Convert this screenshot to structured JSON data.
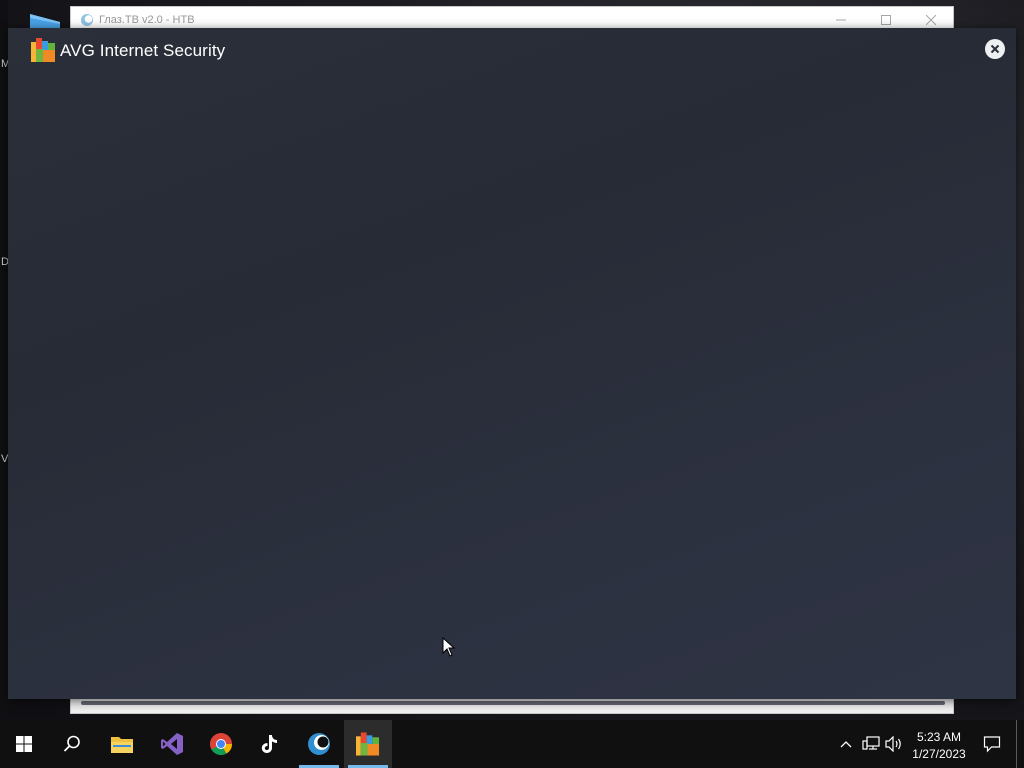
{
  "desktop": {
    "left_strip_chars": [
      "M",
      "D",
      "V"
    ]
  },
  "background_window": {
    "title": "Глаз.ТВ v2.0 - НТВ",
    "icon": "glaz-tv-icon"
  },
  "avg_dialog": {
    "title": "AVG Internet Security",
    "logo": "avg-logo-icon",
    "close": "close-icon",
    "background_color": "#2b2f39"
  },
  "taskbar": {
    "apps": [
      {
        "name": "start",
        "icon": "windows-logo-icon"
      },
      {
        "name": "search",
        "icon": "search-icon"
      },
      {
        "name": "file-explorer",
        "icon": "folder-icon"
      },
      {
        "name": "visual-studio",
        "icon": "visual-studio-icon"
      },
      {
        "name": "chrome",
        "icon": "chrome-icon"
      },
      {
        "name": "tiktok",
        "icon": "tiktok-icon"
      },
      {
        "name": "glaz-tv",
        "icon": "glaz-tv-icon",
        "running": true
      },
      {
        "name": "avg",
        "icon": "avg-icon",
        "running": true,
        "active": true
      }
    ],
    "tray": [
      "chevron-up-icon",
      "network-icon",
      "volume-icon"
    ],
    "clock": {
      "time": "5:23 AM",
      "date": "1/27/2023"
    },
    "accent_color": "#76b9ed"
  }
}
